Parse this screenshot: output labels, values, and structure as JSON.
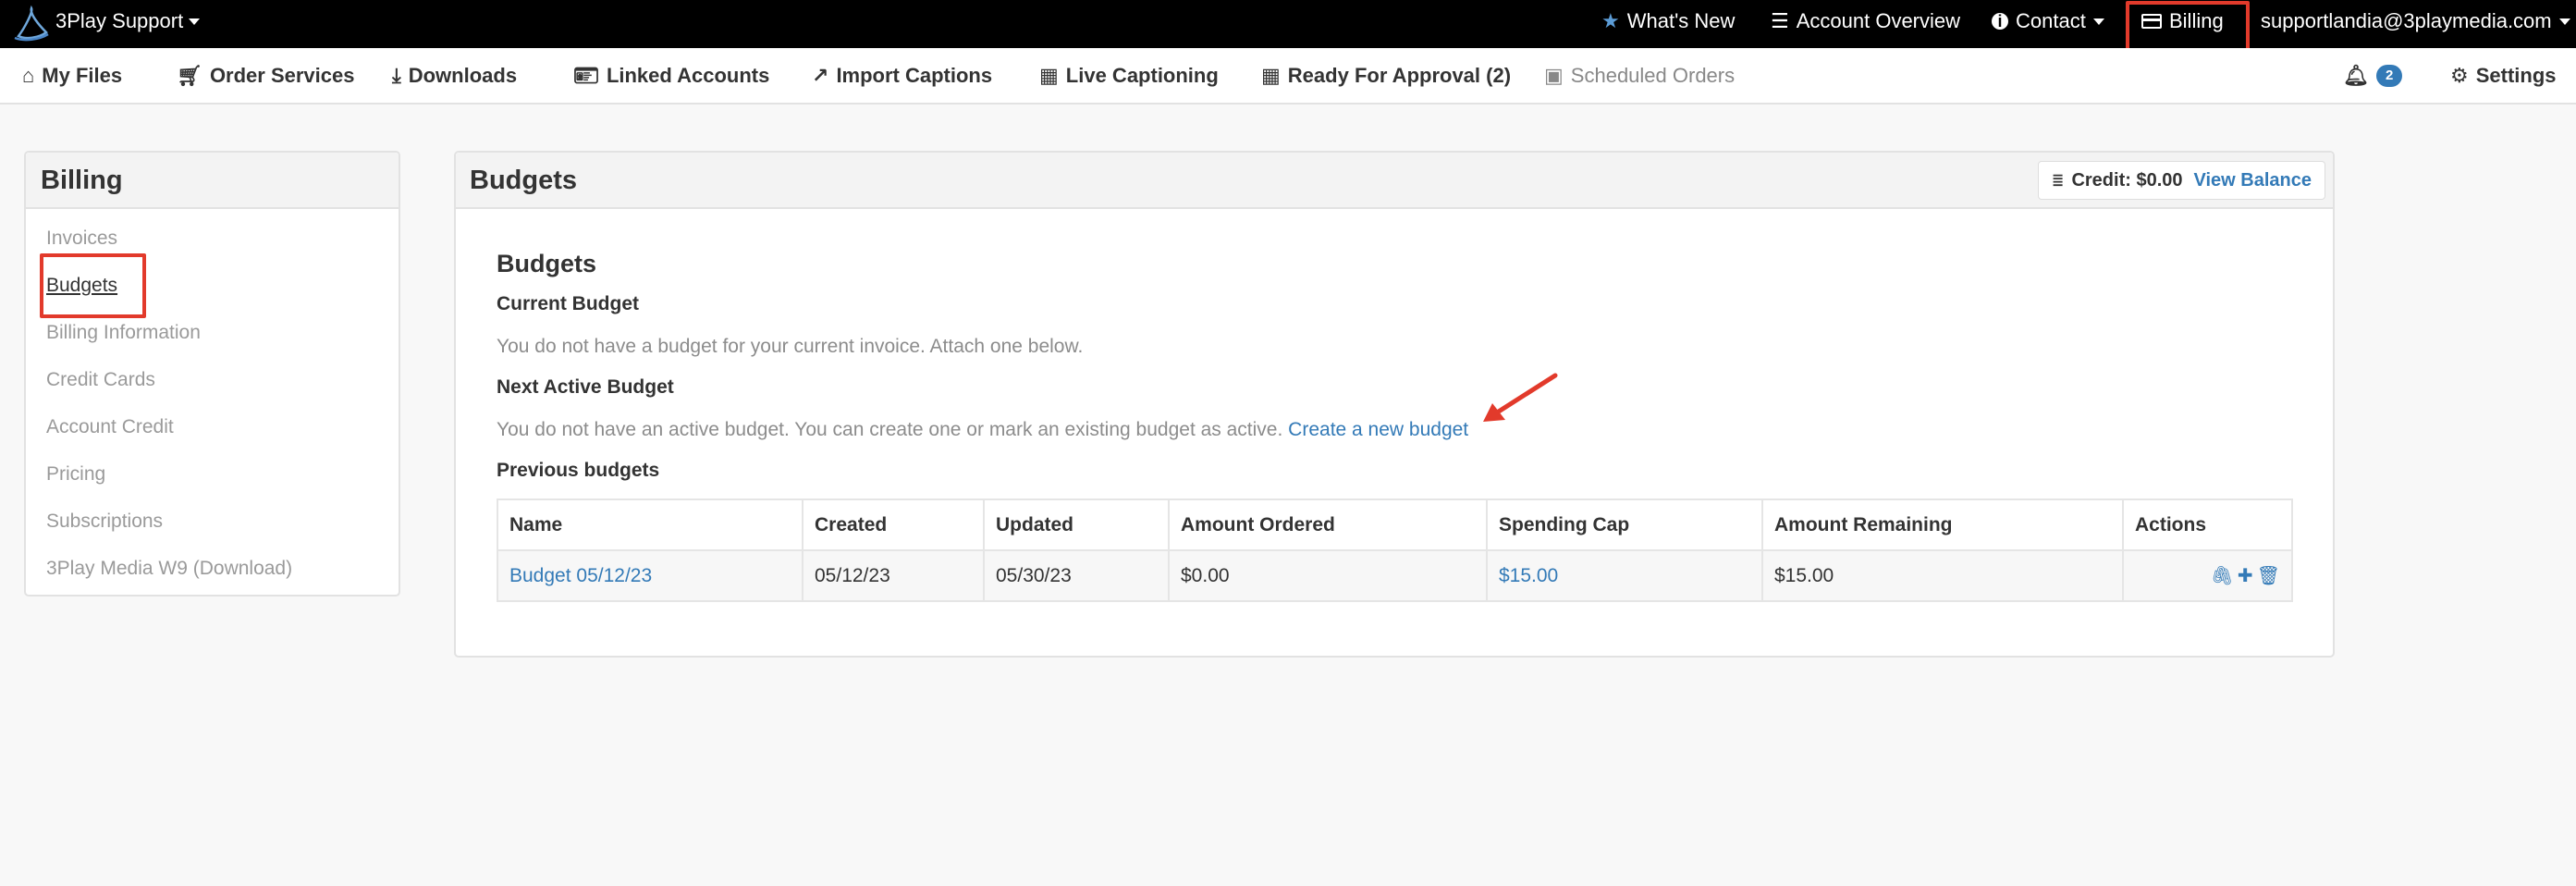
{
  "topbar": {
    "brand": "3Play Support",
    "whats_new": "What's New",
    "account_overview": "Account Overview",
    "contact": "Contact",
    "billing": "Billing",
    "user_email": "supportlandia@3playmedia.com"
  },
  "subnav": {
    "my_files": "My Files",
    "order_services": "Order Services",
    "downloads": "Downloads",
    "linked_accounts": "Linked Accounts",
    "import_captions": "Import Captions",
    "live_captioning": "Live Captioning",
    "ready_for_approval": "Ready For Approval (2)",
    "scheduled_orders": "Scheduled Orders",
    "notification_count": "2",
    "settings": "Settings"
  },
  "sidebar": {
    "title": "Billing",
    "items": [
      {
        "label": "Invoices"
      },
      {
        "label": "Budgets"
      },
      {
        "label": "Billing Information"
      },
      {
        "label": "Credit Cards"
      },
      {
        "label": "Account Credit"
      },
      {
        "label": "Pricing"
      },
      {
        "label": "Subscriptions"
      },
      {
        "label": "3Play Media W9 (Download)"
      }
    ]
  },
  "main": {
    "title": "Budgets",
    "credit_label": "Credit: $0.00",
    "view_balance": "View Balance",
    "section_title": "Budgets",
    "current_budget_heading": "Current Budget",
    "current_budget_text": "You do not have a budget for your current invoice. Attach one below.",
    "next_budget_heading": "Next Active Budget",
    "next_budget_text": "You do not have an active budget. You can create one or mark an existing budget as active.",
    "create_budget_link": "Create a new budget",
    "previous_heading": "Previous budgets",
    "table": {
      "headers": [
        "Name",
        "Created",
        "Updated",
        "Amount Ordered",
        "Spending Cap",
        "Amount Remaining",
        "Actions"
      ],
      "rows": [
        {
          "name": "Budget 05/12/23",
          "created": "05/12/23",
          "updated": "05/30/23",
          "amount_ordered": "$0.00",
          "spending_cap": "$15.00",
          "amount_remaining": "$15.00"
        }
      ]
    }
  },
  "colors": {
    "link": "#337ab7",
    "highlight": "#e23a2b",
    "topbar_bg": "#000000"
  },
  "icons": [
    "logo-icon",
    "star-icon",
    "list-icon",
    "info-icon",
    "credit-card-icon",
    "home-icon",
    "cart-icon",
    "download-icon",
    "id-card-icon",
    "share-icon",
    "calendar-icon",
    "calendar-plus-icon",
    "bell-icon",
    "gear-icon",
    "database-icon",
    "paperclip-icon",
    "plus-icon",
    "trash-icon"
  ]
}
